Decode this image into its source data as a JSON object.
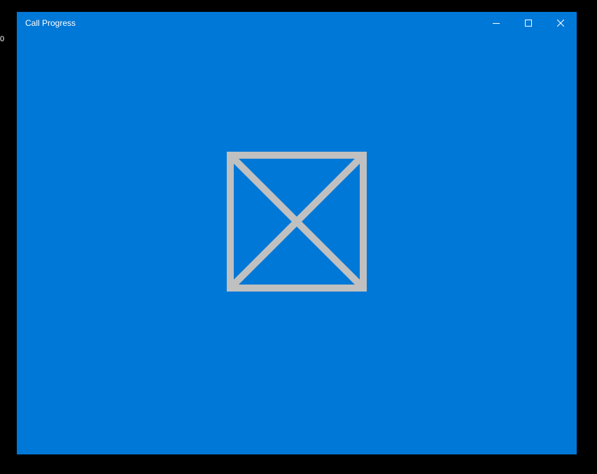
{
  "desktop": {
    "edge_text": "0"
  },
  "window": {
    "title": "Call Progress",
    "background_color": "#0078d7"
  },
  "caption_buttons": {
    "minimize_icon": "minimize-icon",
    "maximize_icon": "maximize-icon",
    "close_icon": "close-icon"
  },
  "content": {
    "placeholder_icon": "missing-image-icon",
    "placeholder_color": "#c0c0c0"
  }
}
